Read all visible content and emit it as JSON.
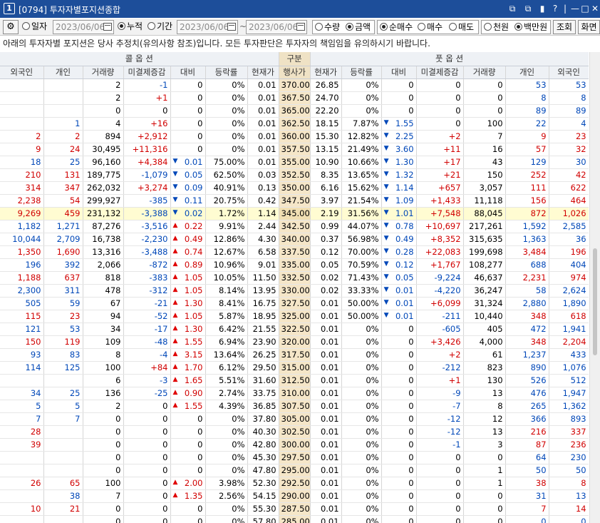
{
  "titlebar": {
    "num": "1",
    "title": "[0794] 투자자별포지션종합",
    "controls": [
      "⧉",
      "⧉",
      "▮",
      "?",
      "|",
      "—",
      "□",
      "✕"
    ]
  },
  "toolbar": {
    "radio_date": "일자",
    "date1": "2023/06/06",
    "radio_cumulative": "누적",
    "radio_period": "기간",
    "date2": "2023/06/06",
    "tilde": "~",
    "date3": "2023/06/06",
    "radio_qty": "수량",
    "radio_amount": "금액",
    "radio_netbuy": "순매수",
    "radio_buy": "매수",
    "radio_sell": "매도",
    "radio_krw1": "천원",
    "radio_krw2": "백만원",
    "inquire": "조회",
    "screen": "화면",
    "selected": [
      "누적",
      "금액",
      "순매수",
      "백만원"
    ]
  },
  "notice": "아래의 투자자별 포지션은 당사 추정치(유의사항 참조)입니다. 모든 투자판단은 투자자의 책임임을 유의하시기 바랍니다.",
  "table": {
    "group_call": "콜 옵 션",
    "group_mid": "구분",
    "group_put": "풋 옵 션",
    "columns": [
      "외국인",
      "개인",
      "거래량",
      "미결제증감",
      "대비",
      "등락률",
      "현재가",
      "행사가",
      "현재가",
      "등락률",
      "대비",
      "미결제증감",
      "거래량",
      "개인",
      "외국인"
    ],
    "highlight_strike": "345.00",
    "rows": [
      [
        "",
        "",
        "2",
        "-1",
        "0",
        "0%",
        "0.01",
        "370.00",
        "26.85",
        "0%",
        "0",
        "0",
        "0",
        "53",
        "53"
      ],
      [
        "",
        "",
        "2",
        "+1",
        "0",
        "0%",
        "0.01",
        "367.50",
        "24.70",
        "0%",
        "0",
        "0",
        "0",
        "8",
        "8"
      ],
      [
        "",
        "",
        "0",
        "0",
        "0",
        "0%",
        "0.01",
        "365.00",
        "22.20",
        "0%",
        "0",
        "0",
        "0",
        "89",
        "89"
      ],
      [
        "",
        "1",
        "4",
        "+16",
        "0",
        "0%",
        "0.01",
        "362.50",
        "18.15",
        "7.87%",
        "▼1.55",
        "0",
        "100",
        "22",
        "4"
      ],
      [
        "2",
        "2",
        "894",
        "+2,912",
        "0",
        "0%",
        "0.01",
        "360.00",
        "15.30",
        "12.82%",
        "▼2.25",
        "+2",
        "7",
        "9",
        "23"
      ],
      [
        "9",
        "24",
        "30,495",
        "+11,316",
        "0",
        "0%",
        "0.01",
        "357.50",
        "13.15",
        "21.49%",
        "▼3.60",
        "+11",
        "16",
        "57",
        "32"
      ],
      [
        "18",
        "25",
        "96,160",
        "+4,384",
        "▼0.01",
        "75.00%",
        "0.01",
        "355.00",
        "10.90",
        "10.66%",
        "▼1.30",
        "+17",
        "43",
        "129",
        "30"
      ],
      [
        "210",
        "131",
        "189,775",
        "-1,079",
        "▼0.05",
        "62.50%",
        "0.03",
        "352.50",
        "8.35",
        "13.65%",
        "▼1.32",
        "+21",
        "150",
        "252",
        "42"
      ],
      [
        "314",
        "347",
        "262,032",
        "+3,274",
        "▼0.09",
        "40.91%",
        "0.13",
        "350.00",
        "6.16",
        "15.62%",
        "▼1.14",
        "+657",
        "3,057",
        "111",
        "622"
      ],
      [
        "2,238",
        "54",
        "299,927",
        "-385",
        "▼0.11",
        "20.75%",
        "0.42",
        "347.50",
        "3.97",
        "21.54%",
        "▼1.09",
        "+1,433",
        "11,118",
        "156",
        "464"
      ],
      [
        "9,269",
        "459",
        "231,132",
        "-3,388",
        "▼0.02",
        "1.72%",
        "1.14",
        "345.00",
        "2.19",
        "31.56%",
        "▼1.01",
        "+7,548",
        "88,045",
        "872",
        "1,026"
      ],
      [
        "1,182",
        "1,271",
        "87,276",
        "-3,516",
        "▲0.22",
        "9.91%",
        "2.44",
        "342.50",
        "0.99",
        "44.07%",
        "▼0.78",
        "+10,697",
        "217,261",
        "1,592",
        "2,585"
      ],
      [
        "10,044",
        "2,709",
        "16,738",
        "-2,230",
        "▲0.49",
        "12.86%",
        "4.30",
        "340.00",
        "0.37",
        "56.98%",
        "▼0.49",
        "+8,352",
        "315,635",
        "1,363",
        "36"
      ],
      [
        "1,350",
        "1,690",
        "13,316",
        "-3,488",
        "▲0.74",
        "12.67%",
        "6.58",
        "337.50",
        "0.12",
        "70.00%",
        "▼0.28",
        "+22,083",
        "199,698",
        "3,484",
        "196"
      ],
      [
        "196",
        "392",
        "2,066",
        "-872",
        "▲0.89",
        "10.96%",
        "9.01",
        "335.00",
        "0.05",
        "70.59%",
        "▼0.12",
        "+1,767",
        "108,277",
        "688",
        "404"
      ],
      [
        "1,188",
        "637",
        "818",
        "-383",
        "▲1.05",
        "10.05%",
        "11.50",
        "332.50",
        "0.02",
        "71.43%",
        "▼0.05",
        "-9,224",
        "46,637",
        "2,231",
        "974"
      ],
      [
        "2,300",
        "311",
        "478",
        "-312",
        "▲1.05",
        "8.14%",
        "13.95",
        "330.00",
        "0.02",
        "33.33%",
        "▼0.01",
        "-4,220",
        "36,247",
        "58",
        "2,624"
      ],
      [
        "505",
        "59",
        "67",
        "-21",
        "▲1.30",
        "8.41%",
        "16.75",
        "327.50",
        "0.01",
        "50.00%",
        "▼0.01",
        "+6,099",
        "31,324",
        "2,880",
        "1,890"
      ],
      [
        "115",
        "23",
        "94",
        "-52",
        "▲1.05",
        "5.87%",
        "18.95",
        "325.00",
        "0.01",
        "50.00%",
        "▼0.01",
        "-211",
        "10,440",
        "348",
        "618"
      ],
      [
        "121",
        "53",
        "34",
        "-17",
        "▲1.30",
        "6.42%",
        "21.55",
        "322.50",
        "0.01",
        "0%",
        "0",
        "-605",
        "405",
        "472",
        "1,941"
      ],
      [
        "150",
        "119",
        "109",
        "-48",
        "▲1.55",
        "6.94%",
        "23.90",
        "320.00",
        "0.01",
        "0%",
        "0",
        "+3,426",
        "4,000",
        "348",
        "2,204"
      ],
      [
        "93",
        "83",
        "8",
        "-4",
        "▲3.15",
        "13.64%",
        "26.25",
        "317.50",
        "0.01",
        "0%",
        "0",
        "+2",
        "61",
        "1,237",
        "433"
      ],
      [
        "114",
        "125",
        "100",
        "+84",
        "▲1.70",
        "6.12%",
        "29.50",
        "315.00",
        "0.01",
        "0%",
        "0",
        "-212",
        "823",
        "890",
        "1,076"
      ],
      [
        "",
        "",
        "6",
        "-3",
        "▲1.65",
        "5.51%",
        "31.60",
        "312.50",
        "0.01",
        "0%",
        "0",
        "+1",
        "130",
        "526",
        "512"
      ],
      [
        "34",
        "25",
        "136",
        "-25",
        "▲0.90",
        "2.74%",
        "33.75",
        "310.00",
        "0.01",
        "0%",
        "0",
        "-9",
        "13",
        "476",
        "1,947"
      ],
      [
        "5",
        "5",
        "2",
        "0",
        "▲1.55",
        "4.39%",
        "36.85",
        "307.50",
        "0.01",
        "0%",
        "0",
        "-7",
        "8",
        "265",
        "1,362"
      ],
      [
        "7",
        "7",
        "0",
        "0",
        "0",
        "0%",
        "37.80",
        "305.00",
        "0.01",
        "0%",
        "0",
        "-12",
        "12",
        "366",
        "893"
      ],
      [
        "28",
        "",
        "0",
        "0",
        "0",
        "0%",
        "40.30",
        "302.50",
        "0.01",
        "0%",
        "0",
        "-12",
        "13",
        "216",
        "337"
      ],
      [
        "39",
        "",
        "0",
        "0",
        "0",
        "0%",
        "42.80",
        "300.00",
        "0.01",
        "0%",
        "0",
        "-1",
        "3",
        "87",
        "236"
      ],
      [
        "",
        "",
        "0",
        "0",
        "0",
        "0%",
        "45.30",
        "297.50",
        "0.01",
        "0%",
        "0",
        "0",
        "0",
        "64",
        "230"
      ],
      [
        "",
        "",
        "0",
        "0",
        "0",
        "0%",
        "47.80",
        "295.00",
        "0.01",
        "0%",
        "0",
        "0",
        "1",
        "50",
        "50"
      ],
      [
        "26",
        "65",
        "100",
        "0",
        "▲2.00",
        "3.98%",
        "52.30",
        "292.50",
        "0.01",
        "0%",
        "0",
        "0",
        "1",
        "38",
        "8"
      ],
      [
        "",
        "38",
        "7",
        "0",
        "▲1.35",
        "2.56%",
        "54.15",
        "290.00",
        "0.01",
        "0%",
        "0",
        "0",
        "0",
        "31",
        "13"
      ],
      [
        "10",
        "21",
        "0",
        "0",
        "0",
        "0%",
        "55.30",
        "287.50",
        "0.01",
        "0%",
        "0",
        "0",
        "0",
        "7",
        "14"
      ],
      [
        "",
        "",
        "0",
        "0",
        "0",
        "0%",
        "57.80",
        "285.00",
        "0.01",
        "0%",
        "0",
        "0",
        "0",
        "0",
        "0"
      ]
    ]
  },
  "colors": {
    "titlebar": "#1d4e9a",
    "up_red": "#d10000",
    "down_blue": "#0047b8",
    "strike_bg": "#f5e6c8",
    "highlight_row": "#fffcd2"
  }
}
